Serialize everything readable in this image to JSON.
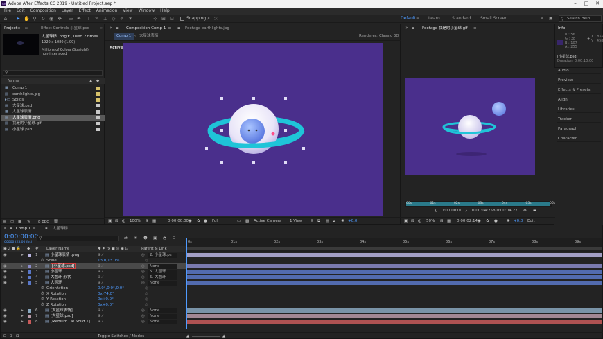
{
  "app": {
    "title": "Adobe After Effects CC 2019 - Untitled Project.aep *",
    "icon_text": "Ae"
  },
  "menu": [
    "File",
    "Edit",
    "Composition",
    "Layer",
    "Effect",
    "Animation",
    "View",
    "Window",
    "Help"
  ],
  "toolbar": {
    "snapping": "Snapping",
    "workspaces": [
      "Default",
      "Learn",
      "Standard",
      "Small Screen"
    ],
    "search_placeholder": "Search Help"
  },
  "project": {
    "tabs": [
      "Project",
      "Effect Controls 小星球.psd"
    ],
    "selected_name": "大星球移 .png ▾ , used 2 times",
    "selected_dims": "1920 x 1080 (1.00)",
    "selected_color": "Millions of Colors (Straight)",
    "selected_interp": "non-interlaced",
    "col_name": "Name",
    "items": [
      {
        "name": "Comp 1",
        "type": "comp",
        "color": "#d6c16a"
      },
      {
        "name": "earthlights.jpg",
        "type": "file",
        "color": "#d6c16a"
      },
      {
        "name": "Solids",
        "type": "folder",
        "color": "#d6c16a"
      },
      {
        "name": "大星球.psd",
        "type": "file",
        "color": "#c9c9c9"
      },
      {
        "name": "大星球表情",
        "type": "comp",
        "color": "#c9c9c9"
      },
      {
        "name": "大星球表情.png",
        "type": "file",
        "color": "#c9c9c9"
      },
      {
        "name": "我是的小星球.gif",
        "type": "file",
        "color": "#c9c9c9"
      },
      {
        "name": "小星球.psd",
        "type": "file",
        "color": "#c9c9c9"
      }
    ],
    "bpc": "8 bpc"
  },
  "comp": {
    "tabs": [
      "Composition Comp 1",
      "Footage earthlights.jpg"
    ],
    "crumbs": [
      "Comp 1",
      "大星球表情"
    ],
    "renderer_label": "Renderer:",
    "renderer": "Classic 3D",
    "view_label": "Active Camera",
    "zoom": "100%",
    "timecode": "0:00:00:00",
    "resolution": "Full",
    "camera": "Active Camera",
    "views": "1 View",
    "exposure": "+0.0"
  },
  "footage": {
    "tab": "Footage 我是的小星球.gif",
    "ruler": [
      "00s",
      "01s",
      "02s",
      "03s",
      "04s",
      "05s",
      "06s"
    ],
    "in": "0:00:00:00",
    "out": "0:00:04:25",
    "dur": "Δ 0:00:04:27",
    "zoom": "50%",
    "timecode": "0:00:02:14",
    "exposure": "+0.0",
    "edit": "Edit"
  },
  "info": {
    "tab": "Info",
    "r": "R : 56",
    "g": "G : 38",
    "b": "B : 107",
    "a": "A : 255",
    "x": "X : 859",
    "y": "Y : 458",
    "layer": "[小星球.psd]",
    "duration": "Duration: 0:00:10:00",
    "panels": [
      "Audio",
      "Preview",
      "Effects & Presets",
      "Align",
      "Libraries",
      "Tracker",
      "Paragraph",
      "Character"
    ]
  },
  "timeline": {
    "tabs": [
      "Comp 1",
      "大星球移"
    ],
    "timecode": "0:00:00:00",
    "fps": "00000 (25.00 fps)",
    "col_layer": "Layer Name",
    "col_parent": "Parent & Link",
    "ruler": [
      "0s",
      "01s",
      "02s",
      "03s",
      "04s",
      "05s",
      "06s",
      "07s",
      "08s",
      "09s"
    ],
    "layers": [
      {
        "num": "1",
        "name": "小星球表情 .png",
        "parent": "2. 小星球.ps",
        "color": "#b9b4e0",
        "level": 0
      },
      {
        "num": "",
        "name": "Scale",
        "value": "13.0,13.0%",
        "level": 1
      },
      {
        "num": "2",
        "name": "[小星球.psd]",
        "parent": "None",
        "color": "#8a8ac8",
        "level": 0,
        "selected": true
      },
      {
        "num": "3",
        "name": "小圆环",
        "parent": "5. 大圆环",
        "color": "#5a78c8",
        "level": 0
      },
      {
        "num": "4",
        "name": "大圆环 形状",
        "parent": "5. 大圆环",
        "color": "#5a78c8",
        "level": 0
      },
      {
        "num": "5",
        "name": "大圆环",
        "parent": "None",
        "color": "#5a78c8",
        "level": 0
      },
      {
        "num": "",
        "name": "Orientation",
        "value": "0.0°,0.0°,0.0°",
        "level": 1
      },
      {
        "num": "",
        "name": "X Rotation",
        "value": "0x-74.0°",
        "level": 1
      },
      {
        "num": "",
        "name": "Y Rotation",
        "value": "0x+0.0°",
        "level": 1
      },
      {
        "num": "",
        "name": "Z Rotation",
        "value": "0x+0.0°",
        "level": 1
      },
      {
        "num": "6",
        "name": "[大星球表情]",
        "parent": "None",
        "color": "#8aa8c0",
        "level": 0
      },
      {
        "num": "7",
        "name": "[大星球.psd]",
        "parent": "None",
        "color": "#b89aa8",
        "level": 0
      },
      {
        "num": "8",
        "name": "[Medium...le Solid 1]",
        "parent": "None",
        "color": "#c85a5a",
        "level": 0
      }
    ],
    "toggle": "Toggle Switches / Modes"
  }
}
